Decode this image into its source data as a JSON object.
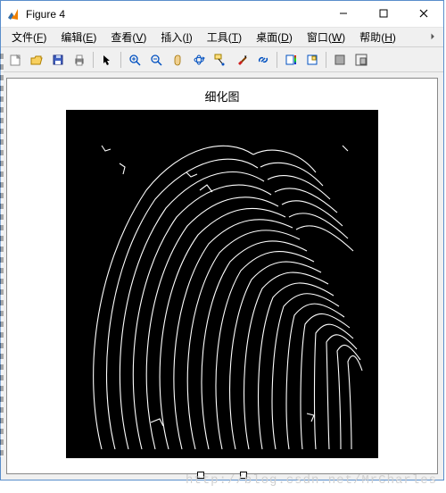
{
  "window": {
    "title": "Figure 4"
  },
  "menu": {
    "file": {
      "label": "文件",
      "hotkey": "F"
    },
    "edit": {
      "label": "编辑",
      "hotkey": "E"
    },
    "view": {
      "label": "查看",
      "hotkey": "V"
    },
    "insert": {
      "label": "插入",
      "hotkey": "I"
    },
    "tools": {
      "label": "工具",
      "hotkey": "T"
    },
    "desktop": {
      "label": "桌面",
      "hotkey": "D"
    },
    "window": {
      "label": "窗口",
      "hotkey": "W"
    },
    "help": {
      "label": "帮助",
      "hotkey": "H"
    }
  },
  "toolbar": {
    "new": "新建图窗",
    "open": "打开",
    "save": "保存",
    "print": "打印",
    "pointer": "编辑绘图",
    "zoomin": "放大",
    "zoomout": "缩小",
    "pan": "平移",
    "rotate": "旋转",
    "datacursor": "数据游标",
    "brush": "刷选",
    "link": "链接",
    "colorbar": "插入颜色栏",
    "legend": "插入图例",
    "hide": "隐藏绘图工具",
    "dock": "停靠图窗"
  },
  "plot": {
    "title": "细化图"
  },
  "watermark": "http://blog.csdn.net/MrCharles"
}
